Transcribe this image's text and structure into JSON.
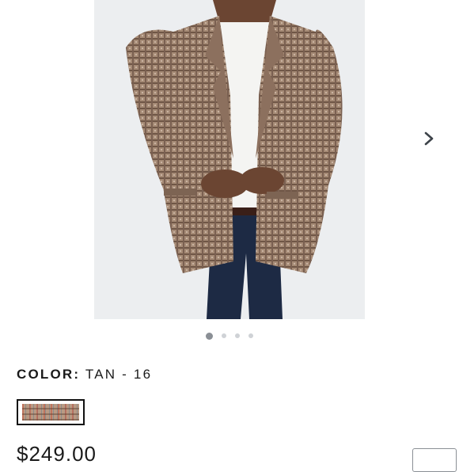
{
  "gallery": {
    "image_alt": "Man wearing tan houndstooth sport coat",
    "dots": [
      {
        "active": true
      },
      {
        "active": false
      },
      {
        "active": false
      },
      {
        "active": false
      }
    ],
    "next_icon": "chevron-right-icon"
  },
  "product": {
    "color_label": "COLOR:",
    "color_value": "TAN - 16",
    "swatch_name": "tan-plaid-swatch",
    "price": "$249.00"
  },
  "colors": {
    "dot_active": "#8a8f95",
    "dot_inactive": "#cfd2d6",
    "text": "#1a1a1a"
  }
}
